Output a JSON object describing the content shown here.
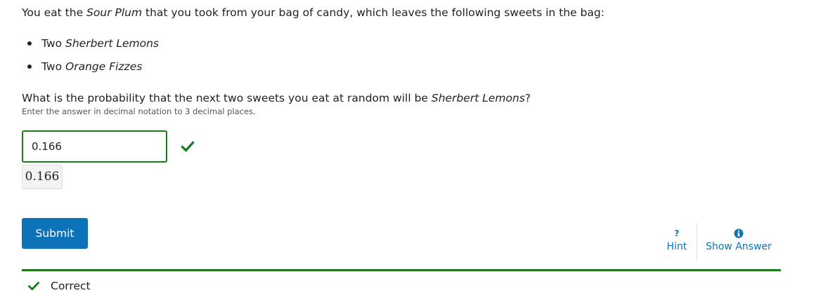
{
  "intro": {
    "before": "You eat the ",
    "item": "Sour Plum",
    "after": " that you took from your bag of candy, which leaves the following sweets in the bag:"
  },
  "sweets": [
    {
      "count": "Two ",
      "name": "Sherbert Lemons"
    },
    {
      "count": "Two ",
      "name": "Orange Fizzes"
    }
  ],
  "question": {
    "before": "What is the probability that the next two sweets you eat at random will be ",
    "item": "Sherbert Lemons",
    "after": "?"
  },
  "instructions": "Enter the answer in decimal notation to 3 decimal places.",
  "answer": {
    "value": "0.166",
    "preview": "0.166",
    "status": "correct"
  },
  "submit_label": "Submit",
  "actions": {
    "hint_label": "Hint",
    "hint_icon": "?",
    "show_answer_label": "Show Answer"
  },
  "feedback": {
    "label": "Correct"
  },
  "colors": {
    "correct": "#1a7a1a",
    "primary": "#0c73b8"
  },
  "icons": {
    "input_status": "checkmark-icon",
    "hint": "question-mark-icon",
    "show_answer": "info-circle-icon",
    "feedback": "checkmark-icon"
  }
}
